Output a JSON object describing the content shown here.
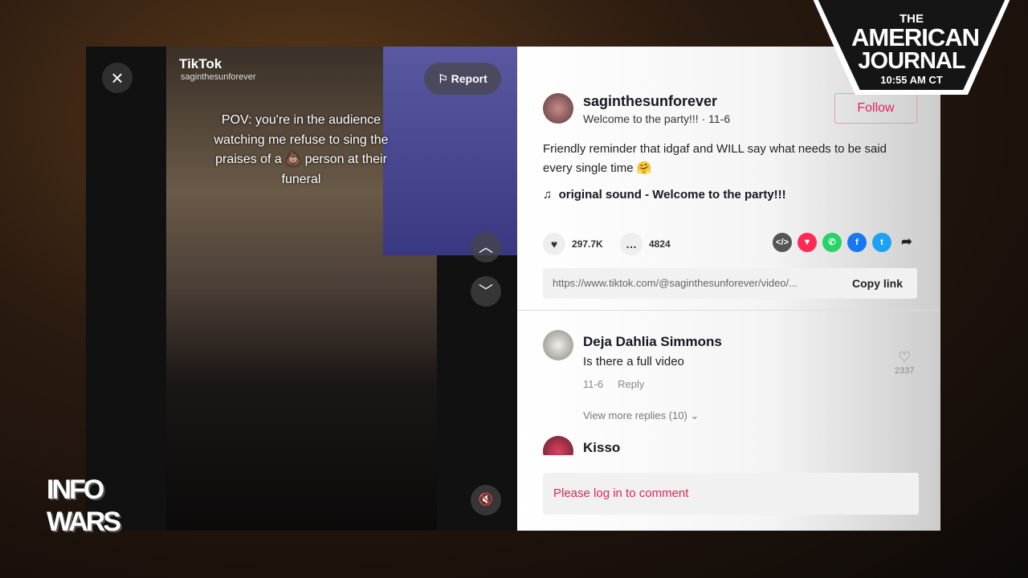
{
  "overlay": {
    "show_title_top": "THE",
    "show_title_main": "AMERICAN",
    "show_title_sub": "JOURNAL",
    "time": "10:55 AM CT",
    "network_logo": "INFOWARS"
  },
  "video": {
    "app": "TikTok",
    "username": "saginthesunforever",
    "report": "Report",
    "caption": "POV: you're in the audience watching me refuse to sing the praises of a 💩 person at their funeral",
    "icons": {
      "close": "close-icon",
      "up": "chevron-up-icon",
      "down": "chevron-down-icon",
      "mute": "mute-icon",
      "flag": "flag-icon"
    }
  },
  "post": {
    "username": "saginthesunforever",
    "subtitle": "Welcome to the party!!! · 11-6",
    "follow": "Follow",
    "description": "Friendly reminder that idgaf and WILL say what needs to be said every single time 🤗",
    "sound": "original sound - Welcome to the party!!!",
    "likes": "297.7K",
    "comments": "4824",
    "link": "https://www.tiktok.com/@saginthesunforever/video/...",
    "copy_link": "Copy link",
    "accent": "#fe2c55"
  },
  "comments": [
    {
      "name": "Deja Dahlia Simmons",
      "text": "Is there a full video",
      "date": "11-6",
      "reply": "Reply",
      "likes": "2337",
      "more": "View more replies (10)"
    },
    {
      "name": "Kisso"
    }
  ],
  "login_prompt": "Please log in to comment"
}
